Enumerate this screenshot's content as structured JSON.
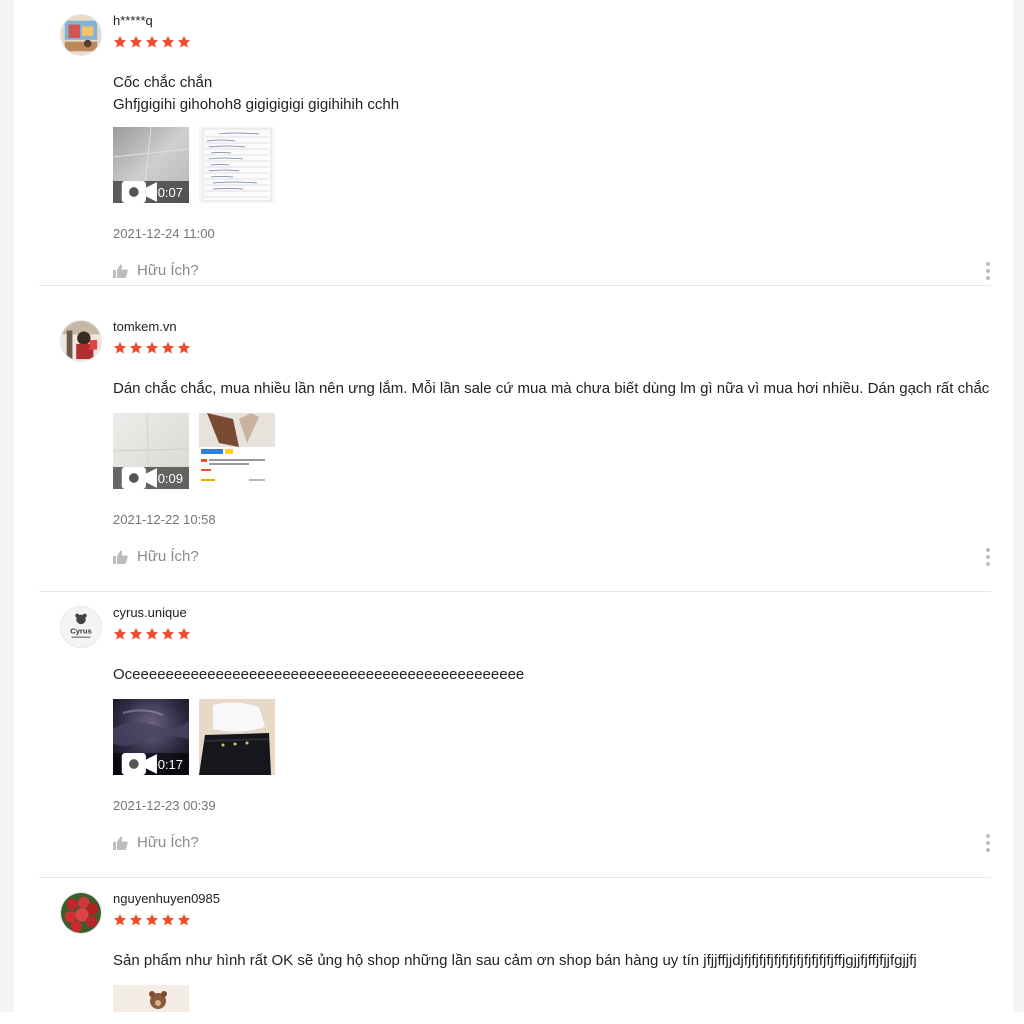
{
  "reviews": [
    {
      "username": "h*****q",
      "rating": 5,
      "comment_lines": [
        "Cốc chắc chắn",
        "Ghfjgigihi gihohoh8 gigigigigi gigihihih cchh"
      ],
      "media": [
        {
          "type": "video",
          "duration": "0:07",
          "thumb": "tile-floor"
        },
        {
          "type": "image",
          "thumb": "notebook-page"
        }
      ],
      "date": "2021-12-24 11:00",
      "helpful_label": "Hữu Ích?"
    },
    {
      "username": "tomkem.vn",
      "rating": 5,
      "comment_lines": [
        "Dán chắc chắc, mua nhiều lần nên ưng lắm. Mỗi lần sale cứ mua mà chưa biết dùng lm gì nữa vì mua hơi nhiều. Dán gạch rất chắc"
      ],
      "media": [
        {
          "type": "video",
          "duration": "0:09",
          "thumb": "tile-floor"
        },
        {
          "type": "image",
          "thumb": "product-screenshot"
        }
      ],
      "date": "2021-12-22 10:58",
      "helpful_label": "Hữu Ích?"
    },
    {
      "username": "cyrus.unique",
      "rating": 5,
      "comment_lines": [
        "Oceeeeeeeeeeeeeeeeeeeeeeeeeeeeeeeeeeeeeeeeeeeeeee"
      ],
      "media": [
        {
          "type": "video",
          "duration": "0:17",
          "thumb": "night-sky"
        },
        {
          "type": "image",
          "thumb": "clothing-photo"
        }
      ],
      "date": "2021-12-23 00:39",
      "helpful_label": "Hữu Ích?"
    },
    {
      "username": "nguyenhuyen0985",
      "rating": 5,
      "comment_lines": [
        "Sản phẩm như hình rất OK sẽ ủng hộ shop những lần sau cảm ơn shop bán hàng uy tín jfjjffjjdjfjfjfjfjfjfjfjfjfjfjfjfjffjgjjfjffjfjjfgjjfj"
      ],
      "media": [
        {
          "type": "image",
          "thumb": "bear-figure"
        }
      ],
      "date": "",
      "helpful_label": ""
    }
  ],
  "colors": {
    "star": "#ee4d2d",
    "date_text": "#757575",
    "helpful_text": "#8a8a8a",
    "divider": "#e8e8e8"
  },
  "icons": {
    "star": "star-icon",
    "video": "video-camera-icon",
    "helpful": "thumbs-up-icon",
    "more": "more-vertical-icon"
  }
}
